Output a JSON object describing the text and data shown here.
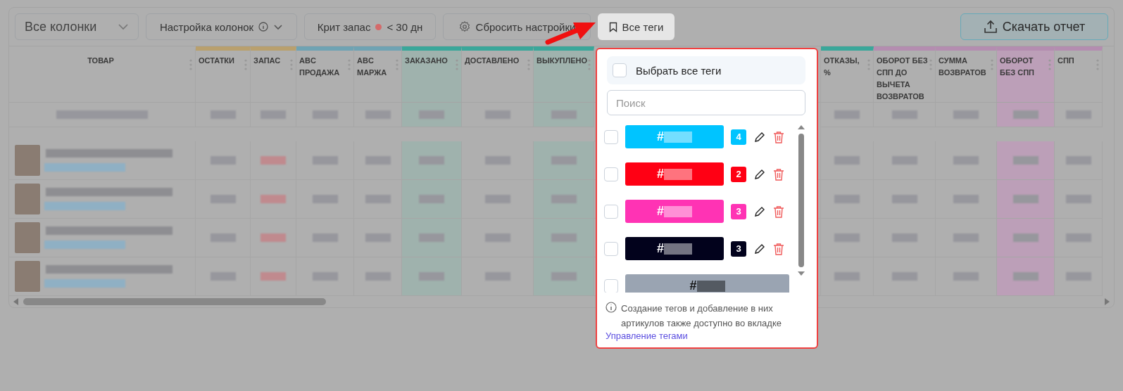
{
  "toolbar": {
    "columns_select": {
      "value": "Все колонки"
    },
    "column_settings": {
      "label": "Настройка колонок"
    },
    "crit_stock": {
      "label": "Крит запас",
      "value": "< 30 дн"
    },
    "reset": {
      "label": "Сбросить настройки"
    },
    "tags": {
      "label": "Все теги",
      "selected": true
    },
    "download": {
      "label": "Скачать отчет"
    }
  },
  "table": {
    "columns": [
      {
        "label": "ТОВАР",
        "highlighted": false
      },
      {
        "label": "ОСТАТКИ",
        "color": "#b9a06e",
        "highlighted": false
      },
      {
        "label": "ЗАПАС",
        "color": "#b9a06e",
        "highlighted": false
      },
      {
        "label": "ABC ПРОДАЖА",
        "color": "#6fa3b3",
        "highlighted": false
      },
      {
        "label": "ABC МАРЖА",
        "color": "#6fa3b3",
        "highlighted": false
      },
      {
        "label": "ЗАКАЗАНО",
        "color": "#3aa79a",
        "highlighted": true
      },
      {
        "label": "ДОСТАВЛЕНО",
        "color": "#3aa79a",
        "highlighted": false
      },
      {
        "label": "ВЫКУПЛЕНО",
        "color": "#3aa79a",
        "highlighted": true
      },
      {
        "label": "ОТКАЗЫ, %",
        "color": "#3aa79a",
        "highlighted": false
      },
      {
        "label": "ОБОРОТ БЕЗ СПП ДО ВЫЧЕТА ВОЗВРАТОВ",
        "color": "#b48db0",
        "highlighted": false
      },
      {
        "label": "СУММА ВОЗВРАТОВ",
        "color": "#b48db0",
        "highlighted": false
      },
      {
        "label": "ОБОРОТ БЕЗ СПП",
        "color": "#b48db0",
        "highlighted": true
      },
      {
        "label": "СПП",
        "color": "#b48db0",
        "highlighted": false
      }
    ]
  },
  "tags_popup": {
    "select_all": {
      "label": "Выбрать все теги",
      "checked": false
    },
    "search": {
      "placeholder": "Поиск"
    },
    "tags": [
      {
        "prefix": "#",
        "color": "#00c4ff",
        "count": "4",
        "checked": false
      },
      {
        "prefix": "#",
        "color": "#ff0014",
        "count": "2",
        "checked": false
      },
      {
        "prefix": "#",
        "color": "#ff33b4",
        "count": "3",
        "checked": false
      },
      {
        "prefix": "#",
        "color": "#02021c",
        "count": "3",
        "checked": false
      },
      {
        "prefix": "#",
        "color": "#9aa4b2",
        "checked": false
      }
    ],
    "note": "Создание тегов и добавление в них артикулов также доступно во вкладке",
    "link": "Управление тегами"
  }
}
